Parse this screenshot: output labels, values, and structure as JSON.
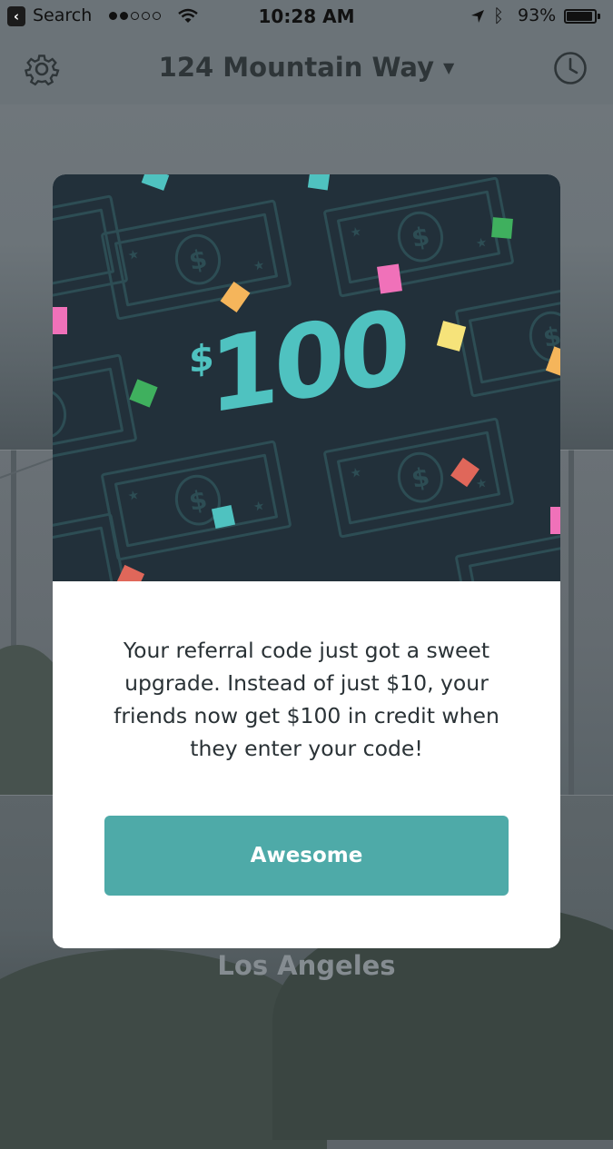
{
  "status_bar": {
    "back_app": "Search",
    "signal_bars": [
      true,
      true,
      false,
      false,
      false
    ],
    "time": "10:28 AM",
    "battery_percent": "93%",
    "battery_level": 0.93,
    "icons": [
      "back-icon",
      "signal-icon",
      "wifi-icon",
      "location-arrow-icon",
      "bluetooth-icon",
      "battery-icon"
    ]
  },
  "nav": {
    "title": "124 Mountain Way",
    "left_icon": "gear-icon",
    "right_icon": "history-clock-icon",
    "title_icon": "caret-down-icon"
  },
  "background": {
    "city_label": "Los Angeles"
  },
  "modal": {
    "hero": {
      "currency_symbol": "$",
      "amount": "100",
      "bill_symbol": "$"
    },
    "message": "Your referral code just got a sweet upgrade. Instead of just $10, your friends now get $100 in credit when they enter your code!",
    "button_label": "Awesome"
  },
  "colors": {
    "accent": "#4eaaa8",
    "amount_text": "#4fc2c0",
    "hero_background": "#22303a",
    "confetti": [
      "#4fc2c0",
      "#f071b9",
      "#f5b55b",
      "#f6e37a",
      "#3fb05e",
      "#e0675a"
    ]
  }
}
